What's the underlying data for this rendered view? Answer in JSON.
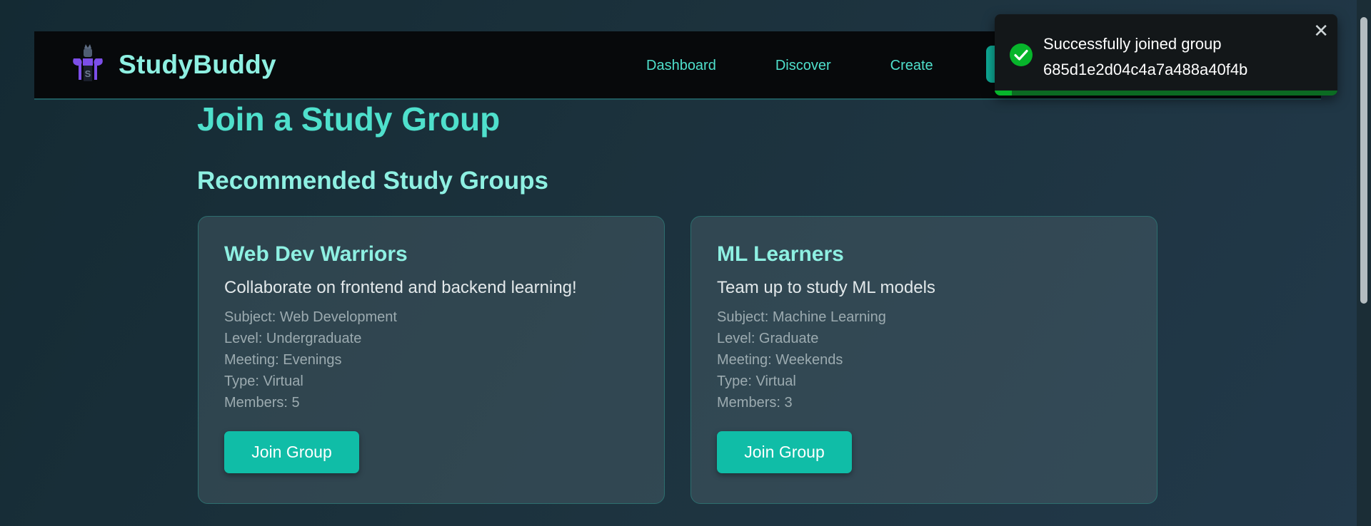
{
  "navbar": {
    "brand": "StudyBuddy",
    "logo_icon": "study-buddy-logo",
    "links": [
      "Dashboard",
      "Discover",
      "Create"
    ]
  },
  "page": {
    "title": "Join a Study Group",
    "section_title": "Recommended Study Groups"
  },
  "groups": [
    {
      "name": "Web Dev Warriors",
      "description": "Collaborate on frontend and backend learning!",
      "subject": "Subject: Web Development",
      "level": "Level: Undergraduate",
      "meeting": "Meeting: Evenings",
      "type": "Type: Virtual",
      "members": "Members: 5",
      "button": "Join Group"
    },
    {
      "name": "ML Learners",
      "description": "Team up to study ML models",
      "subject": "Subject: Machine Learning",
      "level": "Level: Graduate",
      "meeting": "Meeting: Weekends",
      "type": "Type: Virtual",
      "members": "Members: 3",
      "button": "Join Group"
    }
  ],
  "toast": {
    "message": "Successfully joined group 685d1e2d04c4a7a488a40f4b",
    "icon": "check-circle-icon",
    "close_icon": "close-icon",
    "progress_fraction": 0.05
  },
  "colors": {
    "accent": "#4fe0cc",
    "brand": "#8ef0e2",
    "button": "#10bda7",
    "success": "#07b52b"
  }
}
